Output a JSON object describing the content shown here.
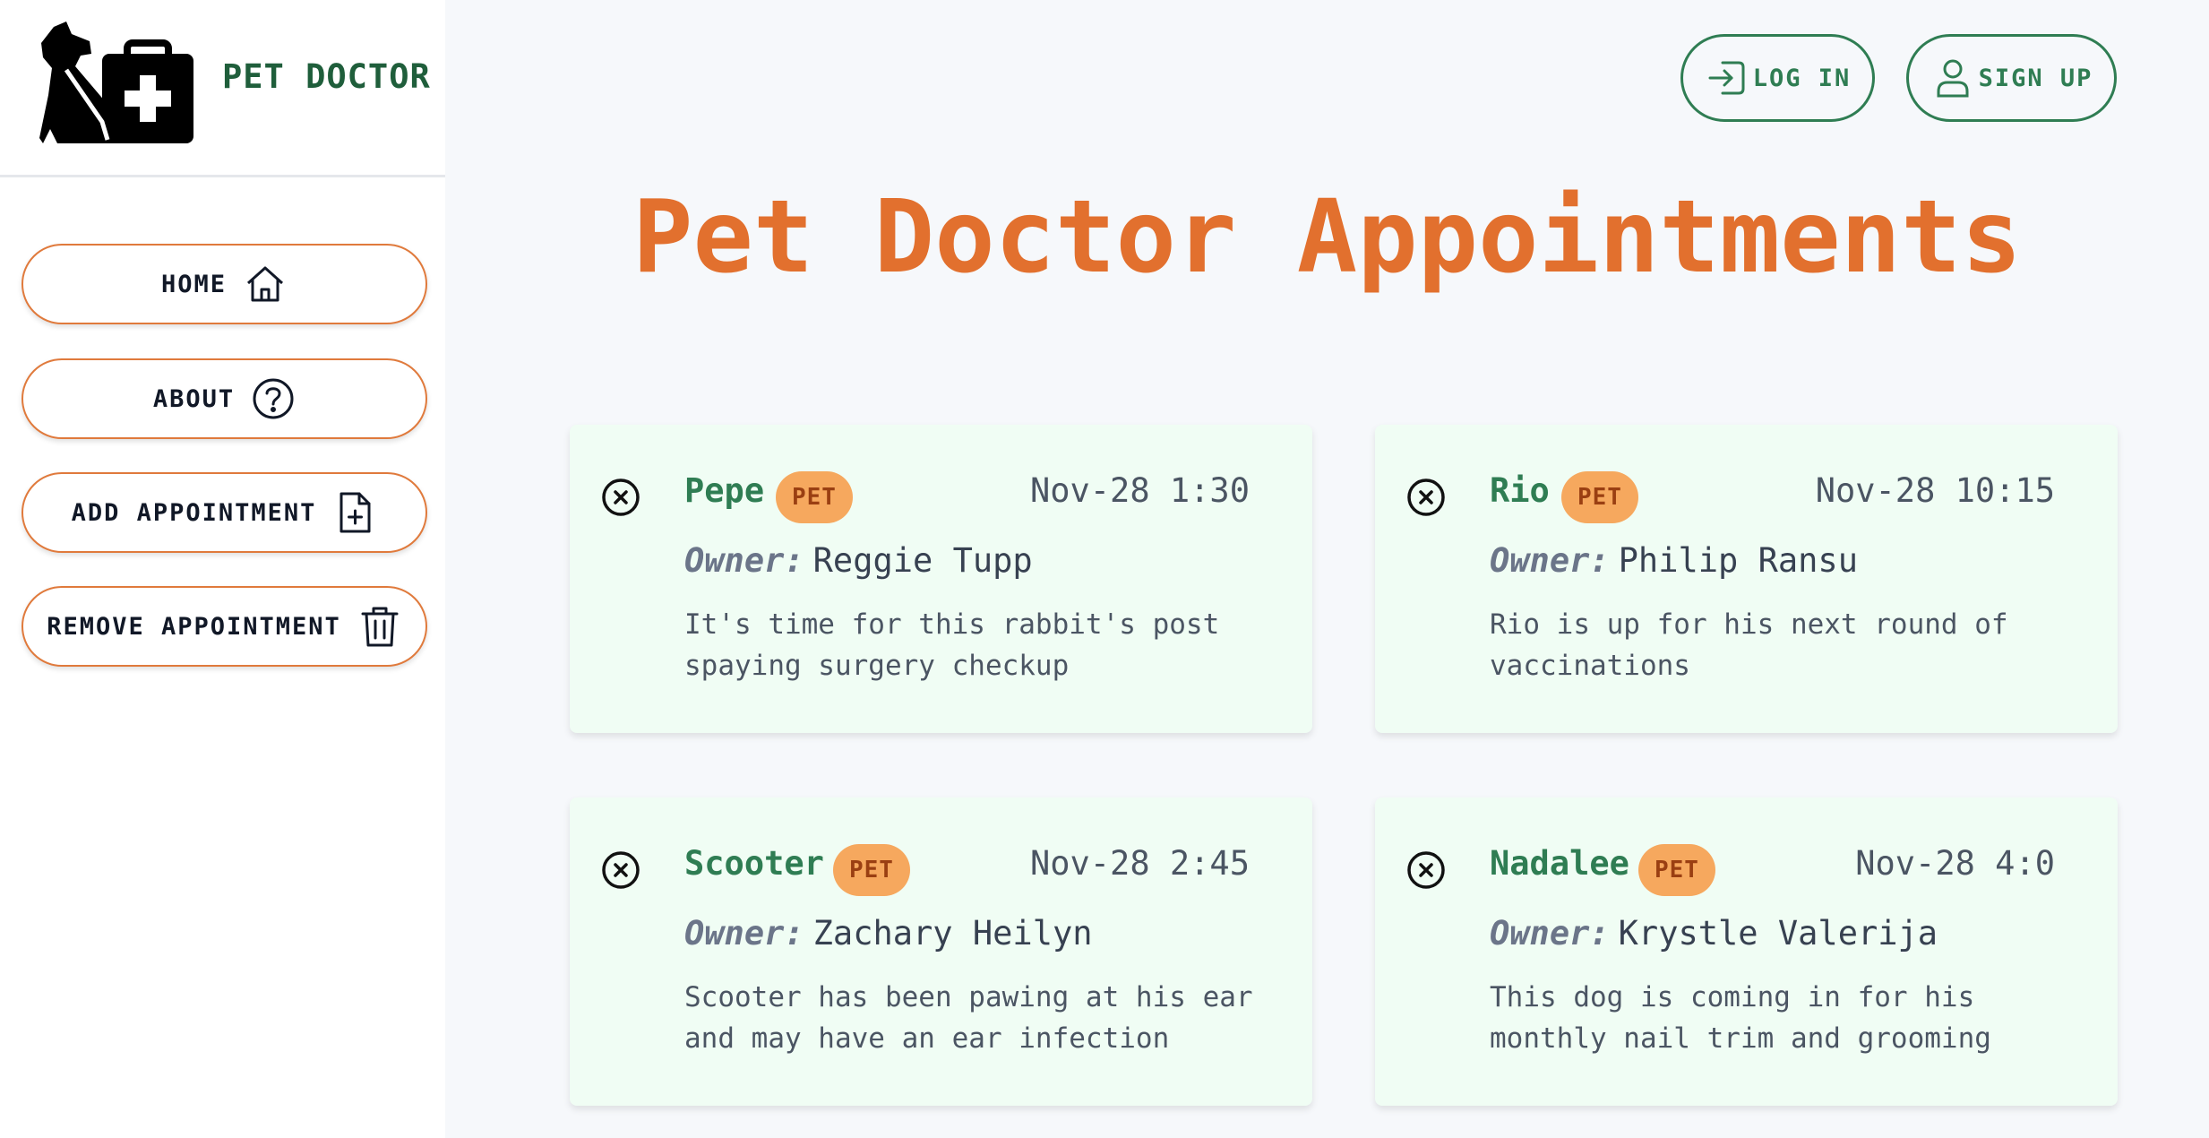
{
  "sidebar": {
    "brand_name": "PET DOCTOR",
    "nav": [
      {
        "label": "HOME",
        "icon": "home-icon"
      },
      {
        "label": "ABOUT",
        "icon": "question-circle-icon"
      },
      {
        "label": "ADD APPOINTMENT",
        "icon": "file-plus-icon"
      },
      {
        "label": "REMOVE APPOINTMENT",
        "icon": "trash-icon"
      }
    ]
  },
  "header": {
    "login_label": "LOG IN",
    "signup_label": "SIGN UP"
  },
  "main": {
    "title": "Pet Doctor Appointments",
    "owner_label": "Owner:",
    "badge_label": "PET",
    "appointments": [
      {
        "pet": "Pepe",
        "date": "Nov-28 1:30",
        "owner": "Reggie Tupp",
        "notes": "It's time for this rabbit's post spaying surgery checkup"
      },
      {
        "pet": "Rio",
        "date": "Nov-28 10:15",
        "owner": "Philip Ransu",
        "notes": "Rio is up for his next round of vaccinations"
      },
      {
        "pet": "Scooter",
        "date": "Nov-28 2:45",
        "owner": "Zachary Heilyn",
        "notes": "Scooter has been pawing at his ear and may have an ear infection"
      },
      {
        "pet": "Nadalee",
        "date": "Nov-28 4:0",
        "owner": "Krystle Valerija",
        "notes": "This dog is coming in for his monthly nail trim and grooming"
      }
    ]
  },
  "colors": {
    "accent_orange": "#e2702e",
    "accent_green": "#2f7d53",
    "card_bg": "#f0fdf4",
    "badge_bg": "#f6a85e"
  }
}
